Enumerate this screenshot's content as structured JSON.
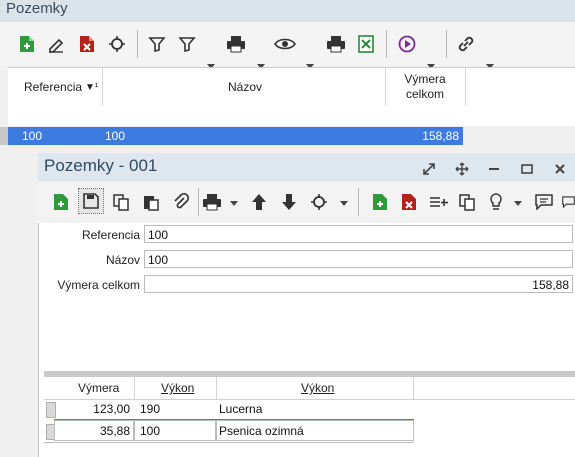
{
  "window": {
    "title": "Pozemky"
  },
  "grid": {
    "columns": [
      {
        "label": "Referencia",
        "sort_indicator": "▼¹"
      },
      {
        "label": "Názov"
      },
      {
        "label": "Výmera\nceľkom"
      }
    ],
    "col3_line1": "Výmera",
    "col3_line2": "celkom",
    "selected_row": {
      "referencia": "100",
      "nazov": "100",
      "vymera": "158,88"
    }
  },
  "dialog": {
    "title": "Pozemky - 001",
    "fields": {
      "referencia": {
        "label": "Referencia",
        "value": "100"
      },
      "nazov": {
        "label": "Názov",
        "value": "100"
      },
      "vymera": {
        "label": "Výmera celkom",
        "value": "158,88"
      }
    },
    "subgrid": {
      "headers": [
        "Výmera",
        "Výkon",
        "Výkon"
      ],
      "rows": [
        {
          "vymera": "123,00",
          "kod": "190",
          "vykon": "Lucerna"
        },
        {
          "vymera": "35,88",
          "kod": "100",
          "vykon": "Psenica ozimná"
        }
      ]
    }
  },
  "colors": {
    "selection": "#3d7be0",
    "title_bg": "#dfe7ee",
    "title_text": "#2e4a66"
  },
  "icons": [
    "add-icon",
    "edit-icon",
    "delete-icon",
    "refresh-icon",
    "filter-icon",
    "filter-menu-icon",
    "print-icon",
    "view-icon",
    "excel-icon",
    "play-icon",
    "link-icon",
    "save-icon",
    "copy-icon",
    "paste-icon",
    "attach-icon",
    "up-arrow-icon",
    "down-arrow-icon",
    "lightbulb-icon",
    "comment-icon",
    "expand-icon",
    "move-icon",
    "minimize-icon",
    "maximize-icon",
    "close-icon"
  ]
}
